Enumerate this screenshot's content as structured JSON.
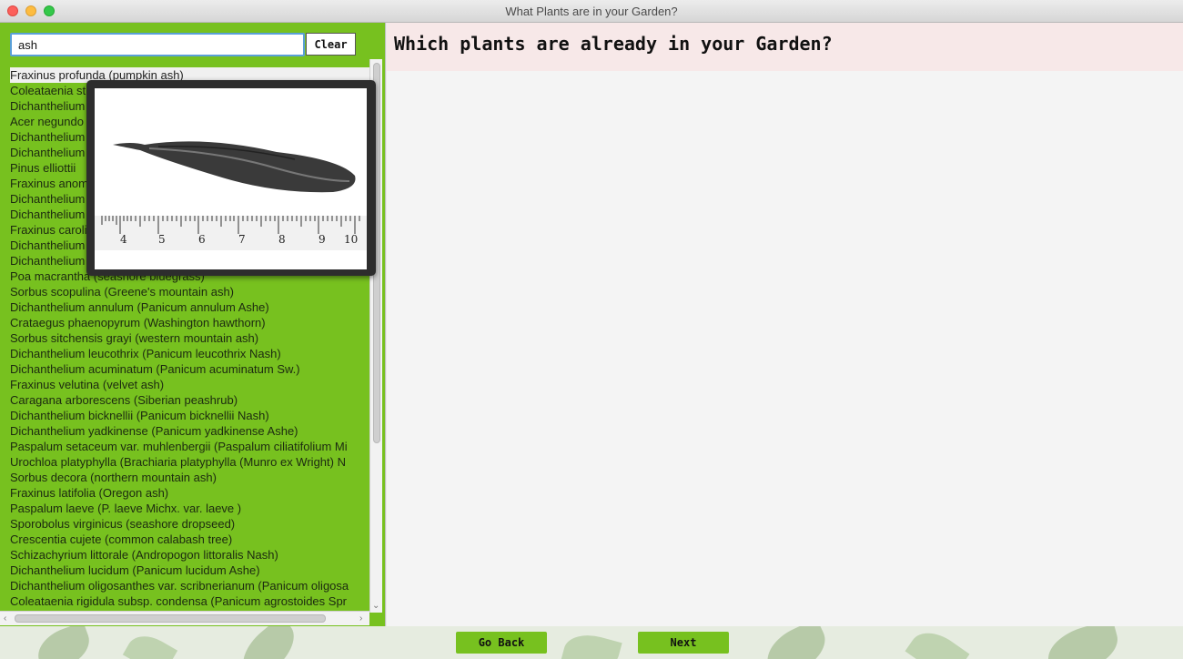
{
  "window": {
    "title": "What Plants are in your Garden?"
  },
  "search": {
    "value": "ash",
    "clear_label": "Clear"
  },
  "plants": [
    "Fraxinus profunda (pumpkin ash)",
    "Coleataenia stipitata (Panicum stipitatum Nash)",
    "Dichanthelium",
    "Acer negundo",
    "Dichanthelium",
    "Dichanthelium",
    "Pinus elliottii",
    "Fraxinus anomala",
    "Dichanthelium",
    "Dichanthelium",
    "Fraxinus caroliniana",
    "Dichanthelium",
    "Dichanthelium",
    "Poa macrantha (seashore bluegrass)",
    "Sorbus scopulina (Greene's mountain ash)",
    "Dichanthelium annulum (Panicum annulum  Ashe)",
    "Crataegus phaenopyrum (Washington hawthorn)",
    "Sorbus sitchensis grayi (western mountain ash)",
    "Dichanthelium leucothrix (Panicum leucothrix  Nash)",
    "Dichanthelium acuminatum (Panicum acuminatum  Sw.)",
    "Fraxinus velutina (velvet ash)",
    "Caragana arborescens (Siberian peashrub)",
    "Dichanthelium bicknellii (Panicum bicknellii  Nash)",
    "Dichanthelium yadkinense (Panicum yadkinense  Ashe)",
    "Paspalum setaceum var. muhlenbergii (Paspalum ciliatifolium  Mi",
    "Urochloa platyphylla (Brachiaria platyphylla  (Munro ex Wright) N",
    "Sorbus decora (northern mountain ash)",
    "Fraxinus latifolia (Oregon ash)",
    "Paspalum laeve (P. laeve  Michx. var. laeve )",
    "Sporobolus virginicus (seashore dropseed)",
    "Crescentia cujete (common calabash tree)",
    "Schizachyrium littorale (Andropogon littoralis  Nash)",
    "Dichanthelium lucidum (Panicum lucidum  Ashe)",
    "Dichanthelium oligosanthes var. scribnerianum (Panicum oligosa",
    "Coleataenia rigidula subsp. condensa (Panicum agrostoides  Spr"
  ],
  "popup": {
    "ruler_labels": [
      "4",
      "5",
      "6",
      "7",
      "8",
      "9",
      "10"
    ]
  },
  "main": {
    "question": "Which plants are already in your Garden?"
  },
  "footer": {
    "back_label": "Go Back",
    "next_label": "Next"
  },
  "colors": {
    "panel_green": "#77c11f",
    "question_band": "#f7e8e8",
    "button_green": "#77c11f"
  }
}
